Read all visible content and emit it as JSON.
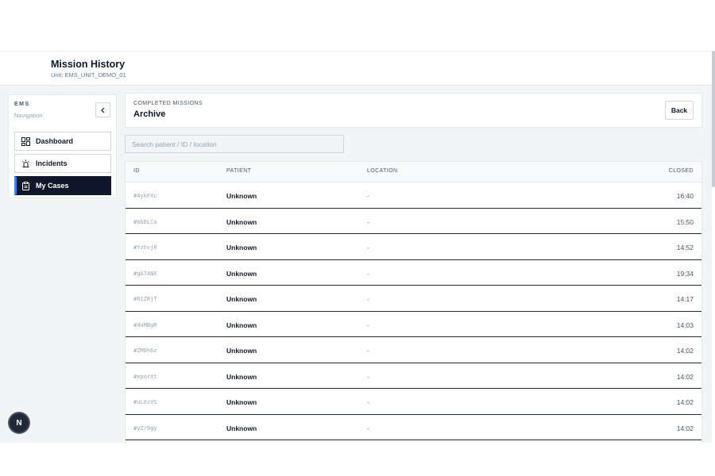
{
  "header": {
    "title": "Mission History",
    "subtitle": "Unit: EMS_UNIT_DEMO_01"
  },
  "sidebar": {
    "brand": "EMS",
    "subtitle": "Navigation",
    "collapse_glyph": "‹",
    "items": [
      {
        "label": "Dashboard",
        "icon": "dashboard-icon",
        "active": false
      },
      {
        "label": "Incidents",
        "icon": "siren-icon",
        "active": false
      },
      {
        "label": "My Cases",
        "icon": "clipboard-icon",
        "active": true
      }
    ]
  },
  "main": {
    "section_label": "COMPLETED MISSIONS",
    "title": "Archive",
    "back_label": "Back",
    "search_placeholder": "Search patient / ID / location"
  },
  "table": {
    "columns": [
      "ID",
      "PATIENT",
      "LOCATION",
      "CLOSED"
    ],
    "rows": [
      {
        "id": "#4ykFXc",
        "patient": "Unknown",
        "location": "-",
        "closed": "16:40"
      },
      {
        "id": "#bbDLCa",
        "patient": "Unknown",
        "location": "-",
        "closed": "15:50"
      },
      {
        "id": "#Yzhvj8",
        "patient": "Unknown",
        "location": "-",
        "closed": "14:52"
      },
      {
        "id": "#gA7ANX",
        "patient": "Unknown",
        "location": "-",
        "closed": "19:34"
      },
      {
        "id": "#61ZRjT",
        "patient": "Unknown",
        "location": "-",
        "closed": "14:17"
      },
      {
        "id": "#duMBgR",
        "patient": "Unknown",
        "location": "-",
        "closed": "14:03"
      },
      {
        "id": "#ZM0h6z",
        "patient": "Unknown",
        "location": "-",
        "closed": "14:02"
      },
      {
        "id": "#eporXt",
        "patient": "Unknown",
        "location": "-",
        "closed": "14:02"
      },
      {
        "id": "#uL0zVS",
        "patient": "Unknown",
        "location": "-",
        "closed": "14:02"
      },
      {
        "id": "#vZr9gy",
        "patient": "Unknown",
        "location": "-",
        "closed": "14:02"
      }
    ]
  },
  "fab": {
    "label": "N"
  },
  "colors": {
    "accent": "#3b82f6",
    "active_bg": "#0f172a",
    "page_bg": "#f3f4f6"
  }
}
